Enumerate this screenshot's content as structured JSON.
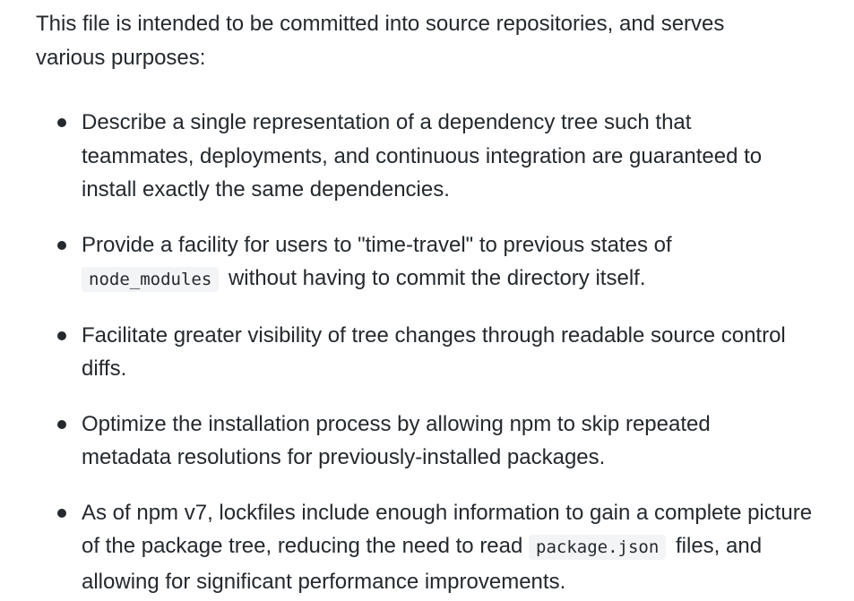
{
  "intro": "This file is intended to be committed into source repositories, and serves various purposes:",
  "items": [
    {
      "text": "Describe a single representation of a dependency tree such that teammates, deployments, and continuous integration are guaranteed to install exactly the same dependencies."
    },
    {
      "before": "Provide a facility for users to \"time-travel\" to previous states of",
      "code": "node_modules",
      "after": "without having to commit the directory itself."
    },
    {
      "text": "Facilitate greater visibility of tree changes through readable source control diffs."
    },
    {
      "text": "Optimize the installation process by allowing npm to skip repeated metadata resolutions for previously-installed packages."
    },
    {
      "before": "As of npm v7, lockfiles include enough information to gain a complete picture of the package tree, reducing the need to read",
      "code": "package.json",
      "after": "files, and allowing for significant performance improvements."
    }
  ]
}
